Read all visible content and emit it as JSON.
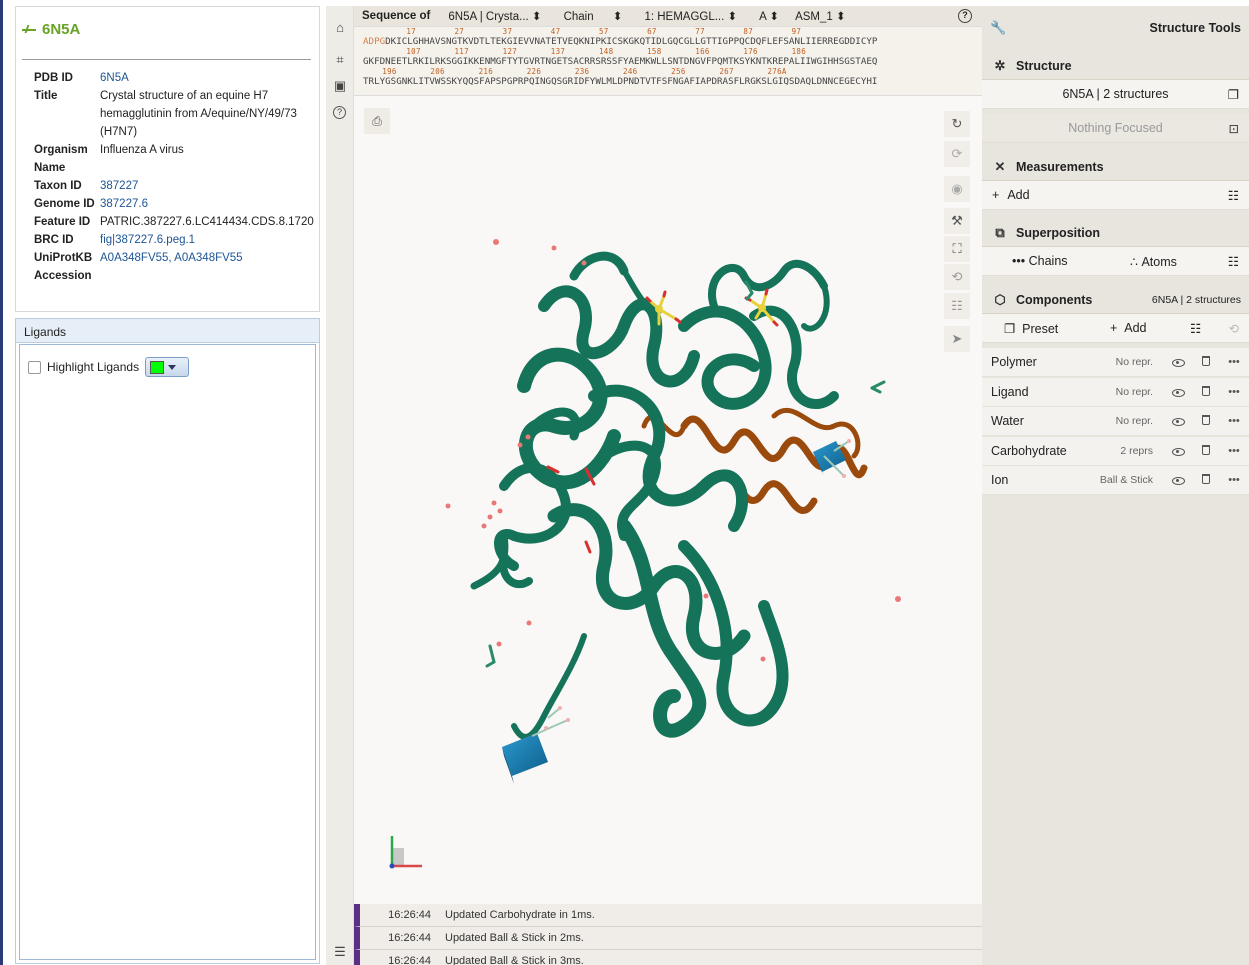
{
  "info": {
    "title": "6N5A",
    "fields": [
      {
        "key": "PDB ID",
        "value": "6N5A",
        "link": true
      },
      {
        "key": "Title",
        "value": "Crystal structure of an equine H7 hemagglutinin from A/equine/NY/49/73 (H7N7)",
        "link": false
      },
      {
        "key": "Organism Name",
        "value": "Influenza A virus",
        "link": false
      },
      {
        "key": "Taxon ID",
        "value": "387227",
        "link": true
      },
      {
        "key": "Genome ID",
        "value": "387227.6",
        "link": true
      },
      {
        "key": "Feature ID",
        "value": "PATRIC.387227.6.LC414434.CDS.8.1720",
        "link": false
      },
      {
        "key": "BRC ID",
        "value": "fig|387227.6.peg.1",
        "link": true
      },
      {
        "key": "UniProtKB Accession",
        "value": "A0A348FV55, A0A348FV55",
        "link": true
      }
    ]
  },
  "ligands": {
    "header": "Ligands",
    "highlight_label": "Highlight Ligands",
    "highlight_checked": false,
    "highlight_color": "#00ff00"
  },
  "sequence": {
    "label": "Sequence of",
    "dropdowns": [
      "6N5A | Crysta...",
      "Chain",
      "1: HEMAGGL...",
      "A",
      "ASM_1"
    ],
    "lines": [
      {
        "nums": "         17        27        37        47        57        67        77        87        97",
        "res_pre": "ADPG",
        "res": "DKICLGHHAVSNGTKVDTLTEKGIEVVNATETVEQKNIPKICSKGKQTIDLGQCGLLGTTIGPPQCDQFLEFSANLIIERREGDDICYP"
      },
      {
        "nums": "         107       117       127       137       148       158       166       176       186",
        "res_pre": "",
        "res": "GKFDNEETLRKILRKSGGIKKENMGFTYTGVRTNGETSACRRSRSSFYAEMKWLLSNTDNGVFPQMTKSYKNTKREPALIIWGIHHSGSTAEQ"
      },
      {
        "nums": "    196       206       216       226       236       246       256       267       276A",
        "res_pre": "",
        "res": "TRLYGSGNKLITVWSSKYQQSFAPSPGPRPQINGQSGRIDFYWLMLDPNDTVTFSFNGAFIAPDRASFLRGKSLGIQSDAQLDNNCEGECYHI"
      }
    ]
  },
  "log": [
    {
      "time": "16:26:44",
      "msg": "Updated Carbohydrate in 1ms."
    },
    {
      "time": "16:26:44",
      "msg": "Updated Ball & Stick in 2ms."
    },
    {
      "time": "16:26:44",
      "msg": "Updated Ball & Stick in 3ms."
    }
  ],
  "tools": {
    "title": "Structure Tools",
    "structure": {
      "header": "Structure",
      "value": "6N5A | 2 structures",
      "focus": "Nothing Focused"
    },
    "measurements": {
      "header": "Measurements",
      "add": "Add"
    },
    "superposition": {
      "header": "Superposition",
      "chains": "Chains",
      "atoms": "Atoms"
    },
    "components": {
      "header": "Components",
      "summary": "6N5A | 2 structures",
      "preset": "Preset",
      "add": "Add",
      "items": [
        {
          "name": "Polymer",
          "repr": "No repr."
        },
        {
          "name": "Ligand",
          "repr": "No repr."
        },
        {
          "name": "Water",
          "repr": "No repr."
        },
        {
          "name": "Carbohydrate",
          "repr": "2 reprs"
        },
        {
          "name": "Ion",
          "repr": "Ball & Stick"
        }
      ]
    }
  },
  "colors": {
    "protein_chain_a": "#15735a",
    "protein_chain_b": "#9a4a0c",
    "carbohydrate": "#1a7fb8",
    "water": "#e87878",
    "sulfur": "#e6d23a",
    "brand_green": "#68a326",
    "log_accent": "#5b2f85"
  }
}
